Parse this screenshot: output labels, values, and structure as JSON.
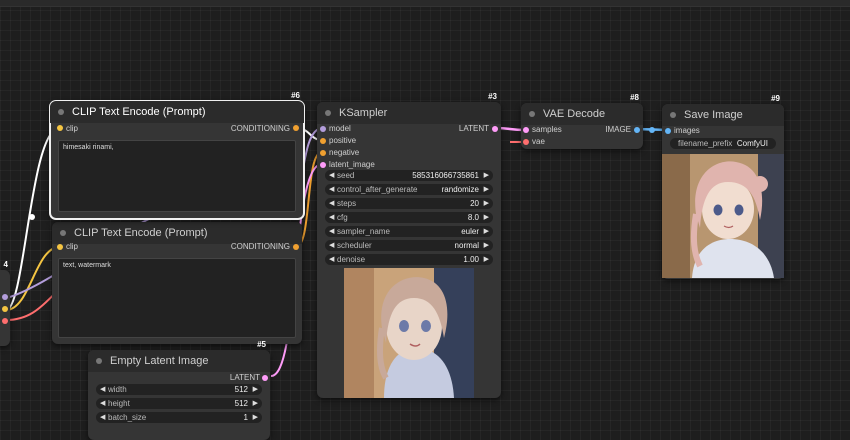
{
  "colors": {
    "clip": "#f5c542",
    "conditioning": "#f0a030",
    "latent": "#ff9cf9",
    "vae": "#ff6e6e",
    "image": "#64b5f6",
    "model": "#b39ddb"
  },
  "partial_node": {
    "id": "4"
  },
  "clip_text_encode_1": {
    "id": "#6",
    "title": "CLIP Text Encode (Prompt)",
    "input_clip": "clip",
    "output_conditioning": "CONDITIONING",
    "text": "himesaki rinami,"
  },
  "clip_text_encode_2": {
    "id": "",
    "title": "CLIP Text Encode (Prompt)",
    "input_clip": "clip",
    "output_conditioning": "CONDITIONING",
    "text": "text, watermark"
  },
  "empty_latent": {
    "id": "#5",
    "title": "Empty Latent Image",
    "output_latent": "LATENT",
    "width_label": "width",
    "width_value": "512",
    "height_label": "height",
    "height_value": "512",
    "batch_label": "batch_size",
    "batch_value": "1"
  },
  "ksampler": {
    "id": "#3",
    "title": "KSampler",
    "inputs": [
      "model",
      "positive",
      "negative",
      "latent_image"
    ],
    "output_latent": "LATENT",
    "widgets": [
      {
        "label": "seed",
        "value": "585316066735861"
      },
      {
        "label": "control_after_generate",
        "value": "randomize"
      },
      {
        "label": "steps",
        "value": "20"
      },
      {
        "label": "cfg",
        "value": "8.0"
      },
      {
        "label": "sampler_name",
        "value": "euler"
      },
      {
        "label": "scheduler",
        "value": "normal"
      },
      {
        "label": "denoise",
        "value": "1.00"
      }
    ]
  },
  "vae_decode": {
    "id": "#8",
    "title": "VAE Decode",
    "input_samples": "samples",
    "input_vae": "vae",
    "output_image": "IMAGE"
  },
  "save_image": {
    "id": "#9",
    "title": "Save Image",
    "input_images": "images",
    "prefix_label": "filename_prefix",
    "prefix_value": "ComfyUI"
  }
}
